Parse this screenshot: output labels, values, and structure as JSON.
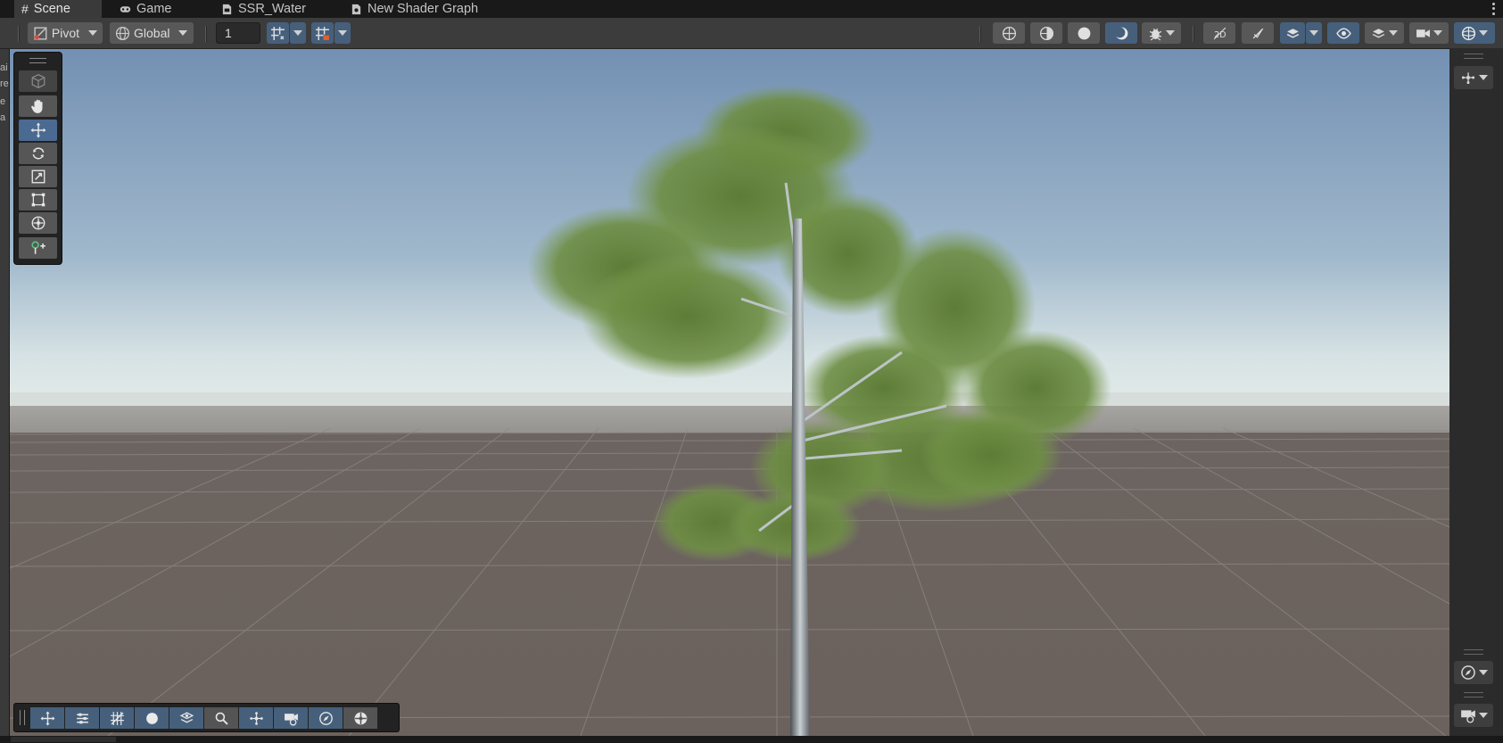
{
  "tabs": [
    {
      "label": "Scene",
      "icon": "hash-icon",
      "active": true
    },
    {
      "label": "Game",
      "icon": "gamepad-icon",
      "active": false
    },
    {
      "label": "SSR_Water",
      "icon": "shader-icon",
      "active": false
    },
    {
      "label": "New Shader Graph",
      "icon": "shader-graph-icon",
      "active": false
    }
  ],
  "toolbar": {
    "pivot_label": "Pivot",
    "global_label": "Global",
    "grid_size_value": "1"
  },
  "left_strip_glyphs": [
    "ai",
    "re",
    "e",
    "a"
  ],
  "tool_palette": {
    "tools": [
      "view-tool",
      "hand-tool",
      "move-tool",
      "rotate-tool",
      "scale-tool",
      "rect-tool",
      "transform-tool",
      "custom-tool"
    ],
    "selected": "move-tool"
  },
  "overlay_tools": [
    "transform-overlay-icon",
    "tool-settings-icon",
    "grid-snapping-icon",
    "draw-mode-icon",
    "navmesh-icon",
    "search-icon",
    "orientation-icon",
    "cameras-icon",
    "compass-icon",
    "ai-navigation-icon"
  ],
  "colors": {
    "accent_blue": "#46607c",
    "selected_tool": "#4a6a92",
    "sky_top": "#7592b4",
    "ground": "#6c625e",
    "foliage": "#6b8a3e"
  }
}
